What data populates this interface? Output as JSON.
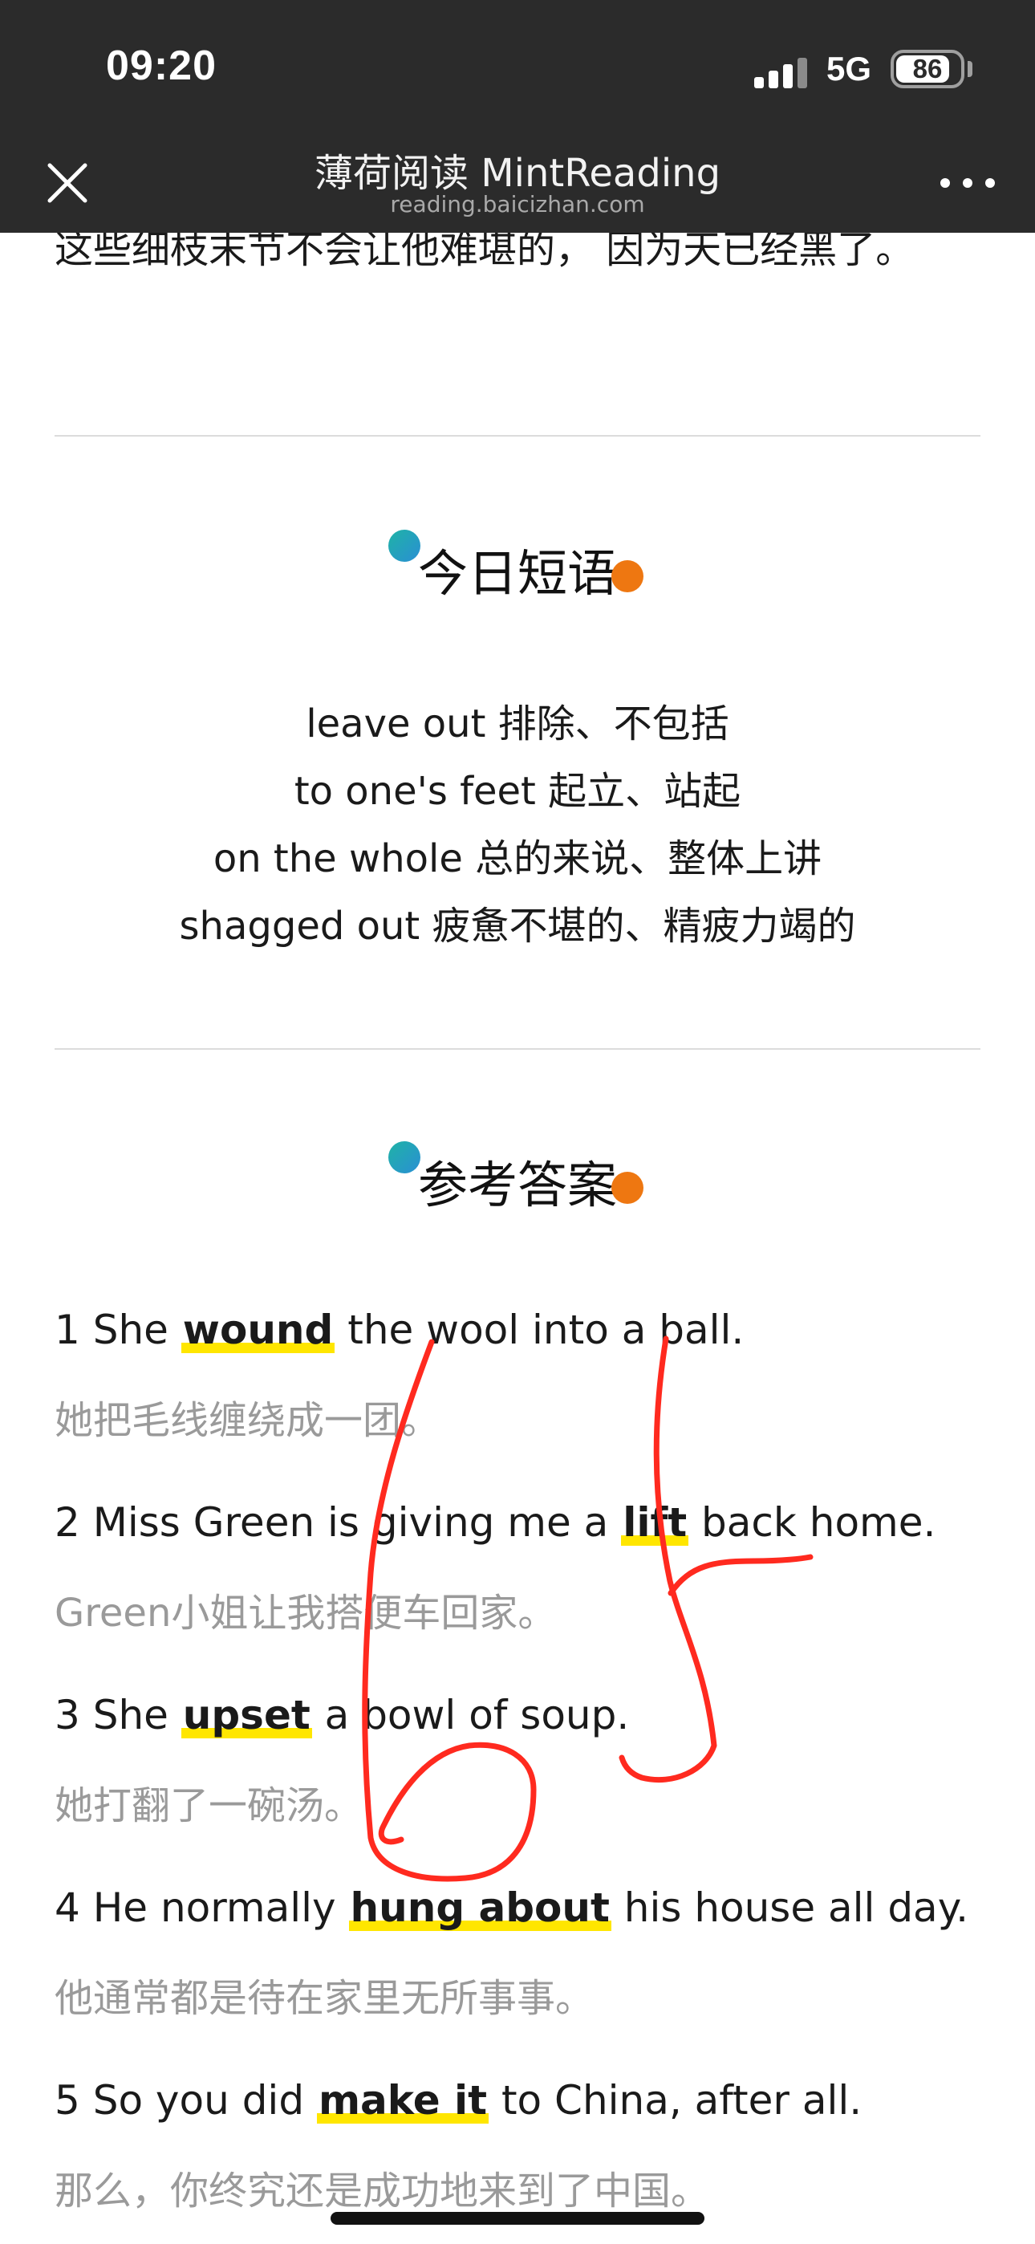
{
  "status_bar": {
    "time": "09:20",
    "network": "5G",
    "battery": "86",
    "battery_level_percent": 86
  },
  "nav": {
    "title": "薄荷阅读 MintReading",
    "subtitle": "reading.baicizhan.com",
    "close_icon": "close-icon",
    "more_icon": "more-dots-icon"
  },
  "prev_text": "这些细枝末节不会让他难堪的， 因为天已经黑了。",
  "phrases_section": {
    "title": "今日短语",
    "items": [
      "leave out 排除、不包括",
      "to one's feet 起立、站起",
      "on the whole 总的来说、整体上讲",
      "shagged out 疲惫不堪的、精疲力竭的"
    ]
  },
  "answers_section": {
    "title": "参考答案",
    "items": [
      {
        "before": "1 She ",
        "highlight": "wound",
        "after": " the wool into a ball.",
        "zh": "她把毛线缠绕成一团。"
      },
      {
        "before": "2 Miss Green is giving me a ",
        "highlight": "lift",
        "after": " back home.",
        "zh": "Green小姐让我搭便车回家。"
      },
      {
        "before": "3 She ",
        "highlight": "upset",
        "after": " a bowl of soup.",
        "zh": "她打翻了一碗汤。"
      },
      {
        "before": "4 He normally ",
        "highlight": "hung about",
        "after": " his house all day.",
        "zh": "他通常都是待在家里无所事事。"
      },
      {
        "before": "5 So you did ",
        "highlight": "make it",
        "after": " to China, after all.",
        "zh": "那么，你终究还是成功地来到了中国。"
      }
    ]
  },
  "annotation": {
    "handwritten_mark": "65",
    "ink_color": "#ff2a1f"
  },
  "colors": {
    "topbar": "#2b2b2b",
    "highlight": "#ffe600",
    "dot_teal": "#1fb3a6",
    "dot_orange": "#ee7711"
  }
}
